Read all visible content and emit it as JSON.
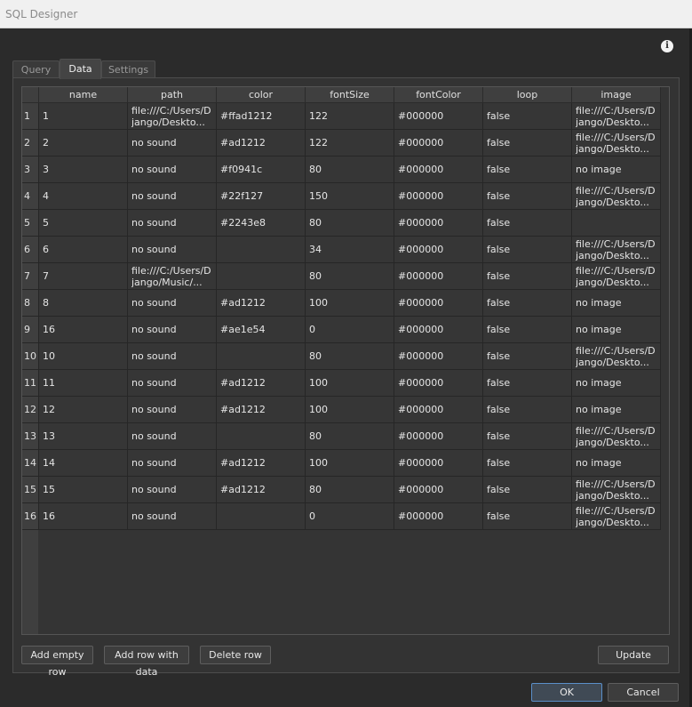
{
  "window": {
    "title": "SQL Designer"
  },
  "tabs": [
    {
      "label": "Query",
      "active": false
    },
    {
      "label": "Data",
      "active": true
    },
    {
      "label": "Settings",
      "active": false
    }
  ],
  "grid": {
    "columns": [
      "name",
      "path",
      "color",
      "fontSize",
      "fontColor",
      "loop",
      "image"
    ],
    "rows": [
      {
        "n": "1",
        "cells": [
          "1",
          "file:///C:/Users/Django/Deskto...",
          "#ffad1212",
          "122",
          "#000000",
          "false",
          "file:///C:/Users/Django/Deskto..."
        ]
      },
      {
        "n": "2",
        "cells": [
          "2",
          "no sound",
          "#ad1212",
          "122",
          "#000000",
          "false",
          "file:///C:/Users/Django/Deskto..."
        ]
      },
      {
        "n": "3",
        "cells": [
          "3",
          "no sound",
          "#f0941c",
          "80",
          "#000000",
          "false",
          "no image"
        ]
      },
      {
        "n": "4",
        "cells": [
          "4",
          "no sound",
          "#22f127",
          "150",
          "#000000",
          "false",
          "file:///C:/Users/Django/Deskto..."
        ]
      },
      {
        "n": "5",
        "cells": [
          "5",
          "no sound",
          "#2243e8",
          "80",
          "#000000",
          "false",
          ""
        ]
      },
      {
        "n": "6",
        "cells": [
          "6",
          "no sound",
          "",
          "34",
          "#000000",
          "false",
          "file:///C:/Users/Django/Deskto..."
        ]
      },
      {
        "n": "7",
        "cells": [
          "7",
          "file:///C:/Users/Django/Music/...",
          "",
          "80",
          "#000000",
          "false",
          "file:///C:/Users/Django/Deskto..."
        ]
      },
      {
        "n": "8",
        "cells": [
          "8",
          "no sound",
          "#ad1212",
          "100",
          "#000000",
          "false",
          "no image"
        ]
      },
      {
        "n": "9",
        "cells": [
          "16",
          "no sound",
          "#ae1e54",
          "0",
          "#000000",
          "false",
          "no image"
        ]
      },
      {
        "n": "10",
        "cells": [
          "10",
          "no sound",
          "",
          "80",
          "#000000",
          "false",
          "file:///C:/Users/Django/Deskto..."
        ]
      },
      {
        "n": "11",
        "cells": [
          "11",
          "no sound",
          "#ad1212",
          "100",
          "#000000",
          "false",
          "no image"
        ]
      },
      {
        "n": "12",
        "cells": [
          "12",
          "no sound",
          "#ad1212",
          "100",
          "#000000",
          "false",
          "no image"
        ]
      },
      {
        "n": "13",
        "cells": [
          "13",
          "no sound",
          "",
          "80",
          "#000000",
          "false",
          "file:///C:/Users/Django/Deskto..."
        ]
      },
      {
        "n": "14",
        "cells": [
          "14",
          "no sound",
          "#ad1212",
          "100",
          "#000000",
          "false",
          "no image"
        ]
      },
      {
        "n": "15",
        "cells": [
          "15",
          "no sound",
          "#ad1212",
          "80",
          "#000000",
          "false",
          "file:///C:/Users/Django/Deskto..."
        ]
      },
      {
        "n": "16",
        "cells": [
          "16",
          "no sound",
          "",
          "0",
          "#000000",
          "false",
          "file:///C:/Users/Django/Deskto..."
        ]
      }
    ]
  },
  "actions": {
    "add_empty_row": "Add empty row",
    "add_row_with_data": "Add row with data",
    "delete_row": "Delete row",
    "update": "Update"
  },
  "dialog": {
    "ok": "OK",
    "cancel": "Cancel"
  },
  "icons": {
    "info": "info-icon"
  },
  "colors": {
    "background": "#2b2b2b",
    "accent": "#5a8fc9"
  }
}
